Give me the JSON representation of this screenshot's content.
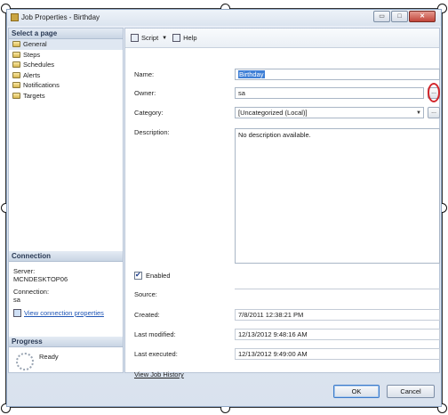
{
  "window": {
    "title": "Job Properties - Birthday"
  },
  "window_buttons": {
    "minimize": "▭",
    "maximize": "□",
    "close": "✕"
  },
  "left": {
    "select_page_header": "Select a page",
    "pages": [
      "General",
      "Steps",
      "Schedules",
      "Alerts",
      "Notifications",
      "Targets"
    ],
    "selected_page": "General",
    "connection_header": "Connection",
    "server_label": "Server:",
    "server_value": "MCNDESKTOP06",
    "connection_label": "Connection:",
    "connection_value": "sa",
    "view_connection_link": "View connection properties",
    "progress_header": "Progress",
    "progress_status": "Ready"
  },
  "toolbar": {
    "script_label": "Script",
    "help_label": "Help"
  },
  "form": {
    "name_label": "Name:",
    "name_value": "Birthday",
    "owner_label": "Owner:",
    "owner_value": "sa",
    "browse_label": "...",
    "category_label": "Category:",
    "category_value": "[Uncategorized (Local)]",
    "description_label": "Description:",
    "description_value": "No description available.",
    "enabled_label": "Enabled",
    "enabled_checked": true,
    "source_label": "Source:",
    "created_label": "Created:",
    "created_value": "7/8/2011 12:38:21 PM",
    "last_modified_label": "Last modified:",
    "last_modified_value": "12/13/2012 9:48:16 AM",
    "last_executed_label": "Last executed:",
    "last_executed_value": "12/13/2012 9:49:00 AM",
    "view_history_link": "View Job History"
  },
  "buttons": {
    "ok": "OK",
    "cancel": "Cancel"
  },
  "colors": {
    "selection_accent": "#3e7fd6",
    "highlight_ring": "#d3262b",
    "link": "#1f55b5"
  }
}
